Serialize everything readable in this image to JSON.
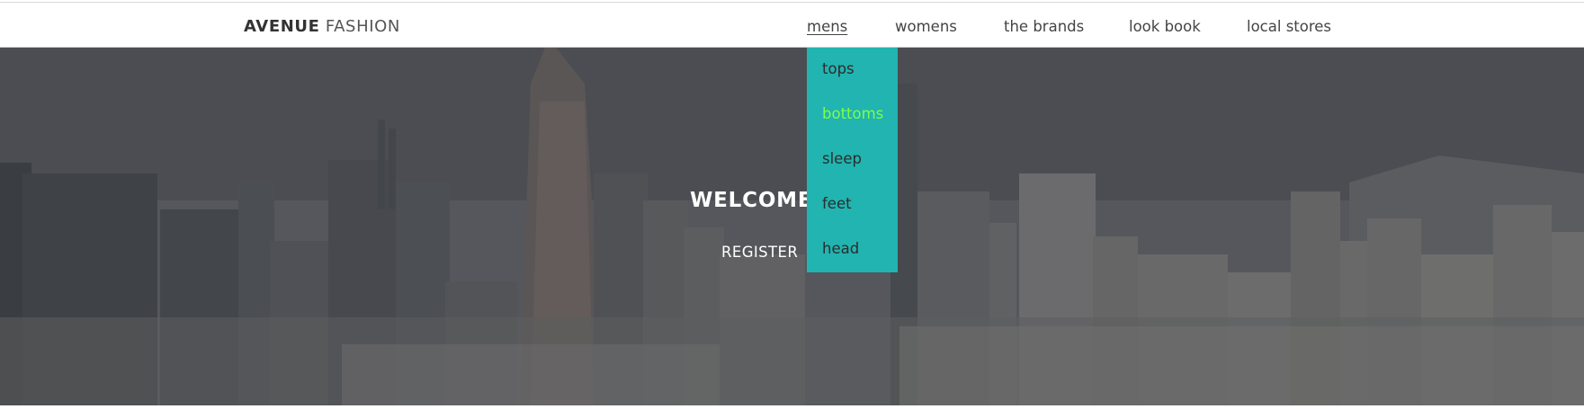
{
  "header": {
    "brand_bold": "AVENUE",
    "brand_light": "FASHION",
    "nav": [
      {
        "label": "mens"
      },
      {
        "label": "womens"
      },
      {
        "label": "the brands"
      },
      {
        "label": "look book"
      },
      {
        "label": "local stores"
      }
    ]
  },
  "dropdown": {
    "items": [
      {
        "label": "tops"
      },
      {
        "label": "bottoms"
      },
      {
        "label": "sleep"
      },
      {
        "label": "feet"
      },
      {
        "label": "head"
      }
    ],
    "highlighted_item": "bottoms"
  },
  "hero": {
    "title": "WELCOME",
    "subtitle": "REGISTER"
  },
  "colors": {
    "dropdown_bg": "#21b4b0",
    "highlight_text": "#7dff4b",
    "brand_text": "#333333"
  }
}
